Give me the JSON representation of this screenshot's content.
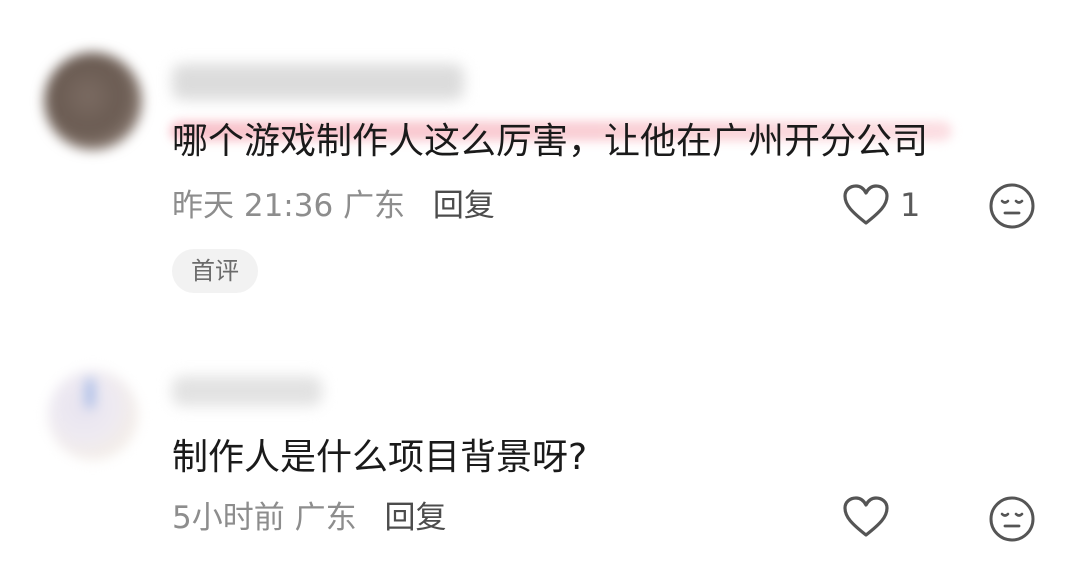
{
  "comments": [
    {
      "text": "哪个游戏制作人这么厉害，让他在广州开分公司",
      "time": "昨天 21:36",
      "location": "广东",
      "reply_label": "回复",
      "like_count": "1",
      "badge": "首评",
      "like_icon": "heart-outline-icon",
      "emoji_icon": "neutral-face-icon",
      "highlighted": true
    },
    {
      "text": "制作人是什么项目背景呀?",
      "time": "5小时前",
      "location": "广东",
      "reply_label": "回复",
      "like_icon": "heart-outline-icon",
      "emoji_icon": "neutral-face-icon"
    }
  ],
  "colors": {
    "highlight": "#f7b7c1",
    "meta_text": "#8d8d8d",
    "reply_text": "#4c4c4c",
    "badge_bg": "#f2f2f2"
  }
}
